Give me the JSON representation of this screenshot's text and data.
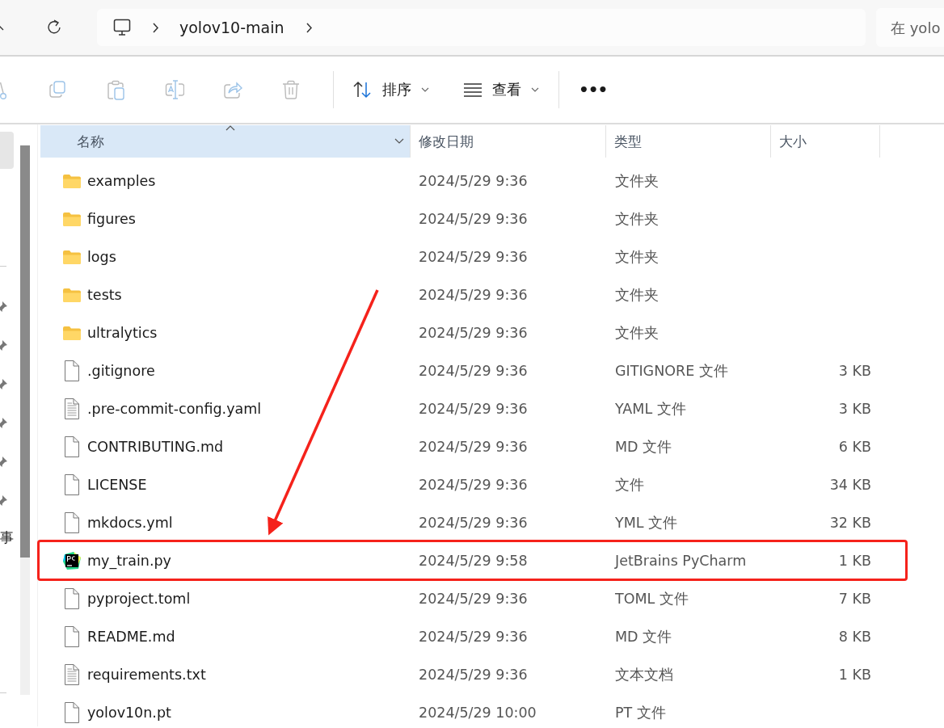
{
  "address_bar": {
    "breadcrumbs": [
      "yolov10-main"
    ],
    "search": {
      "placeholder": "在 yolo"
    }
  },
  "toolbar": {
    "icon_buttons": [
      {
        "kind": "cut",
        "disabled": true
      },
      {
        "kind": "copy",
        "disabled": true
      },
      {
        "kind": "paste",
        "disabled": true
      },
      {
        "kind": "rename",
        "disabled": true
      },
      {
        "kind": "share",
        "disabled": true
      },
      {
        "kind": "delete",
        "disabled": true
      }
    ],
    "menus": [
      {
        "kind": "sort",
        "label": "排序"
      },
      {
        "kind": "view",
        "label": "查看"
      }
    ],
    "more": "•••"
  },
  "nav_pane": {
    "label_fragment": "事"
  },
  "file_list": {
    "columns": [
      {
        "label": "名称",
        "highlighted": true,
        "sorted": true
      },
      {
        "label": "修改日期",
        "highlighted": false,
        "sorted": false
      },
      {
        "label": "类型",
        "highlighted": false,
        "sorted": false
      },
      {
        "label": "大小",
        "highlighted": false,
        "sorted": false
      }
    ],
    "rows": [
      {
        "kind": "folder",
        "name": "examples",
        "modified": "2024/5/29 9:36",
        "type": "文件夹",
        "highlighted": false
      },
      {
        "kind": "folder",
        "name": "figures",
        "modified": "2024/5/29 9:36",
        "type": "文件夹",
        "highlighted": false
      },
      {
        "kind": "folder",
        "name": "logs",
        "modified": "2024/5/29 9:36",
        "type": "文件夹",
        "highlighted": false
      },
      {
        "kind": "folder",
        "name": "tests",
        "modified": "2024/5/29 9:36",
        "type": "文件夹",
        "highlighted": false
      },
      {
        "kind": "folder",
        "name": "ultralytics",
        "modified": "2024/5/29 9:36",
        "type": "文件夹",
        "highlighted": false
      },
      {
        "kind": "file",
        "name": ".gitignore",
        "modified": "2024/5/29 9:36",
        "type": "GITIGNORE 文件",
        "size": "3 KB",
        "highlighted": false
      },
      {
        "kind": "text",
        "name": ".pre-commit-config.yaml",
        "modified": "2024/5/29 9:36",
        "type": "YAML 文件",
        "size": "3 KB",
        "highlighted": false
      },
      {
        "kind": "file",
        "name": "CONTRIBUTING.md",
        "modified": "2024/5/29 9:36",
        "type": "MD 文件",
        "size": "6 KB",
        "highlighted": false
      },
      {
        "kind": "file",
        "name": "LICENSE",
        "modified": "2024/5/29 9:36",
        "type": "文件",
        "size": "34 KB",
        "highlighted": false
      },
      {
        "kind": "file",
        "name": "mkdocs.yml",
        "modified": "2024/5/29 9:36",
        "type": "YML 文件",
        "size": "32 KB",
        "highlighted": false
      },
      {
        "kind": "pycharm",
        "name": "my_train.py",
        "modified": "2024/5/29 9:58",
        "type": "JetBrains PyCharm",
        "size": "1 KB",
        "highlighted": true
      },
      {
        "kind": "file",
        "name": "pyproject.toml",
        "modified": "2024/5/29 9:36",
        "type": "TOML 文件",
        "size": "7 KB",
        "highlighted": false
      },
      {
        "kind": "file",
        "name": "README.md",
        "modified": "2024/5/29 9:36",
        "type": "MD 文件",
        "size": "8 KB",
        "highlighted": false
      },
      {
        "kind": "text",
        "name": "requirements.txt",
        "modified": "2024/5/29 9:36",
        "type": "文本文档",
        "size": "1 KB",
        "highlighted": false
      },
      {
        "kind": "file",
        "name": "yolov10n.pt",
        "modified": "2024/5/29 10:00",
        "type": "PT 文件",
        "highlighted": false
      }
    ]
  }
}
